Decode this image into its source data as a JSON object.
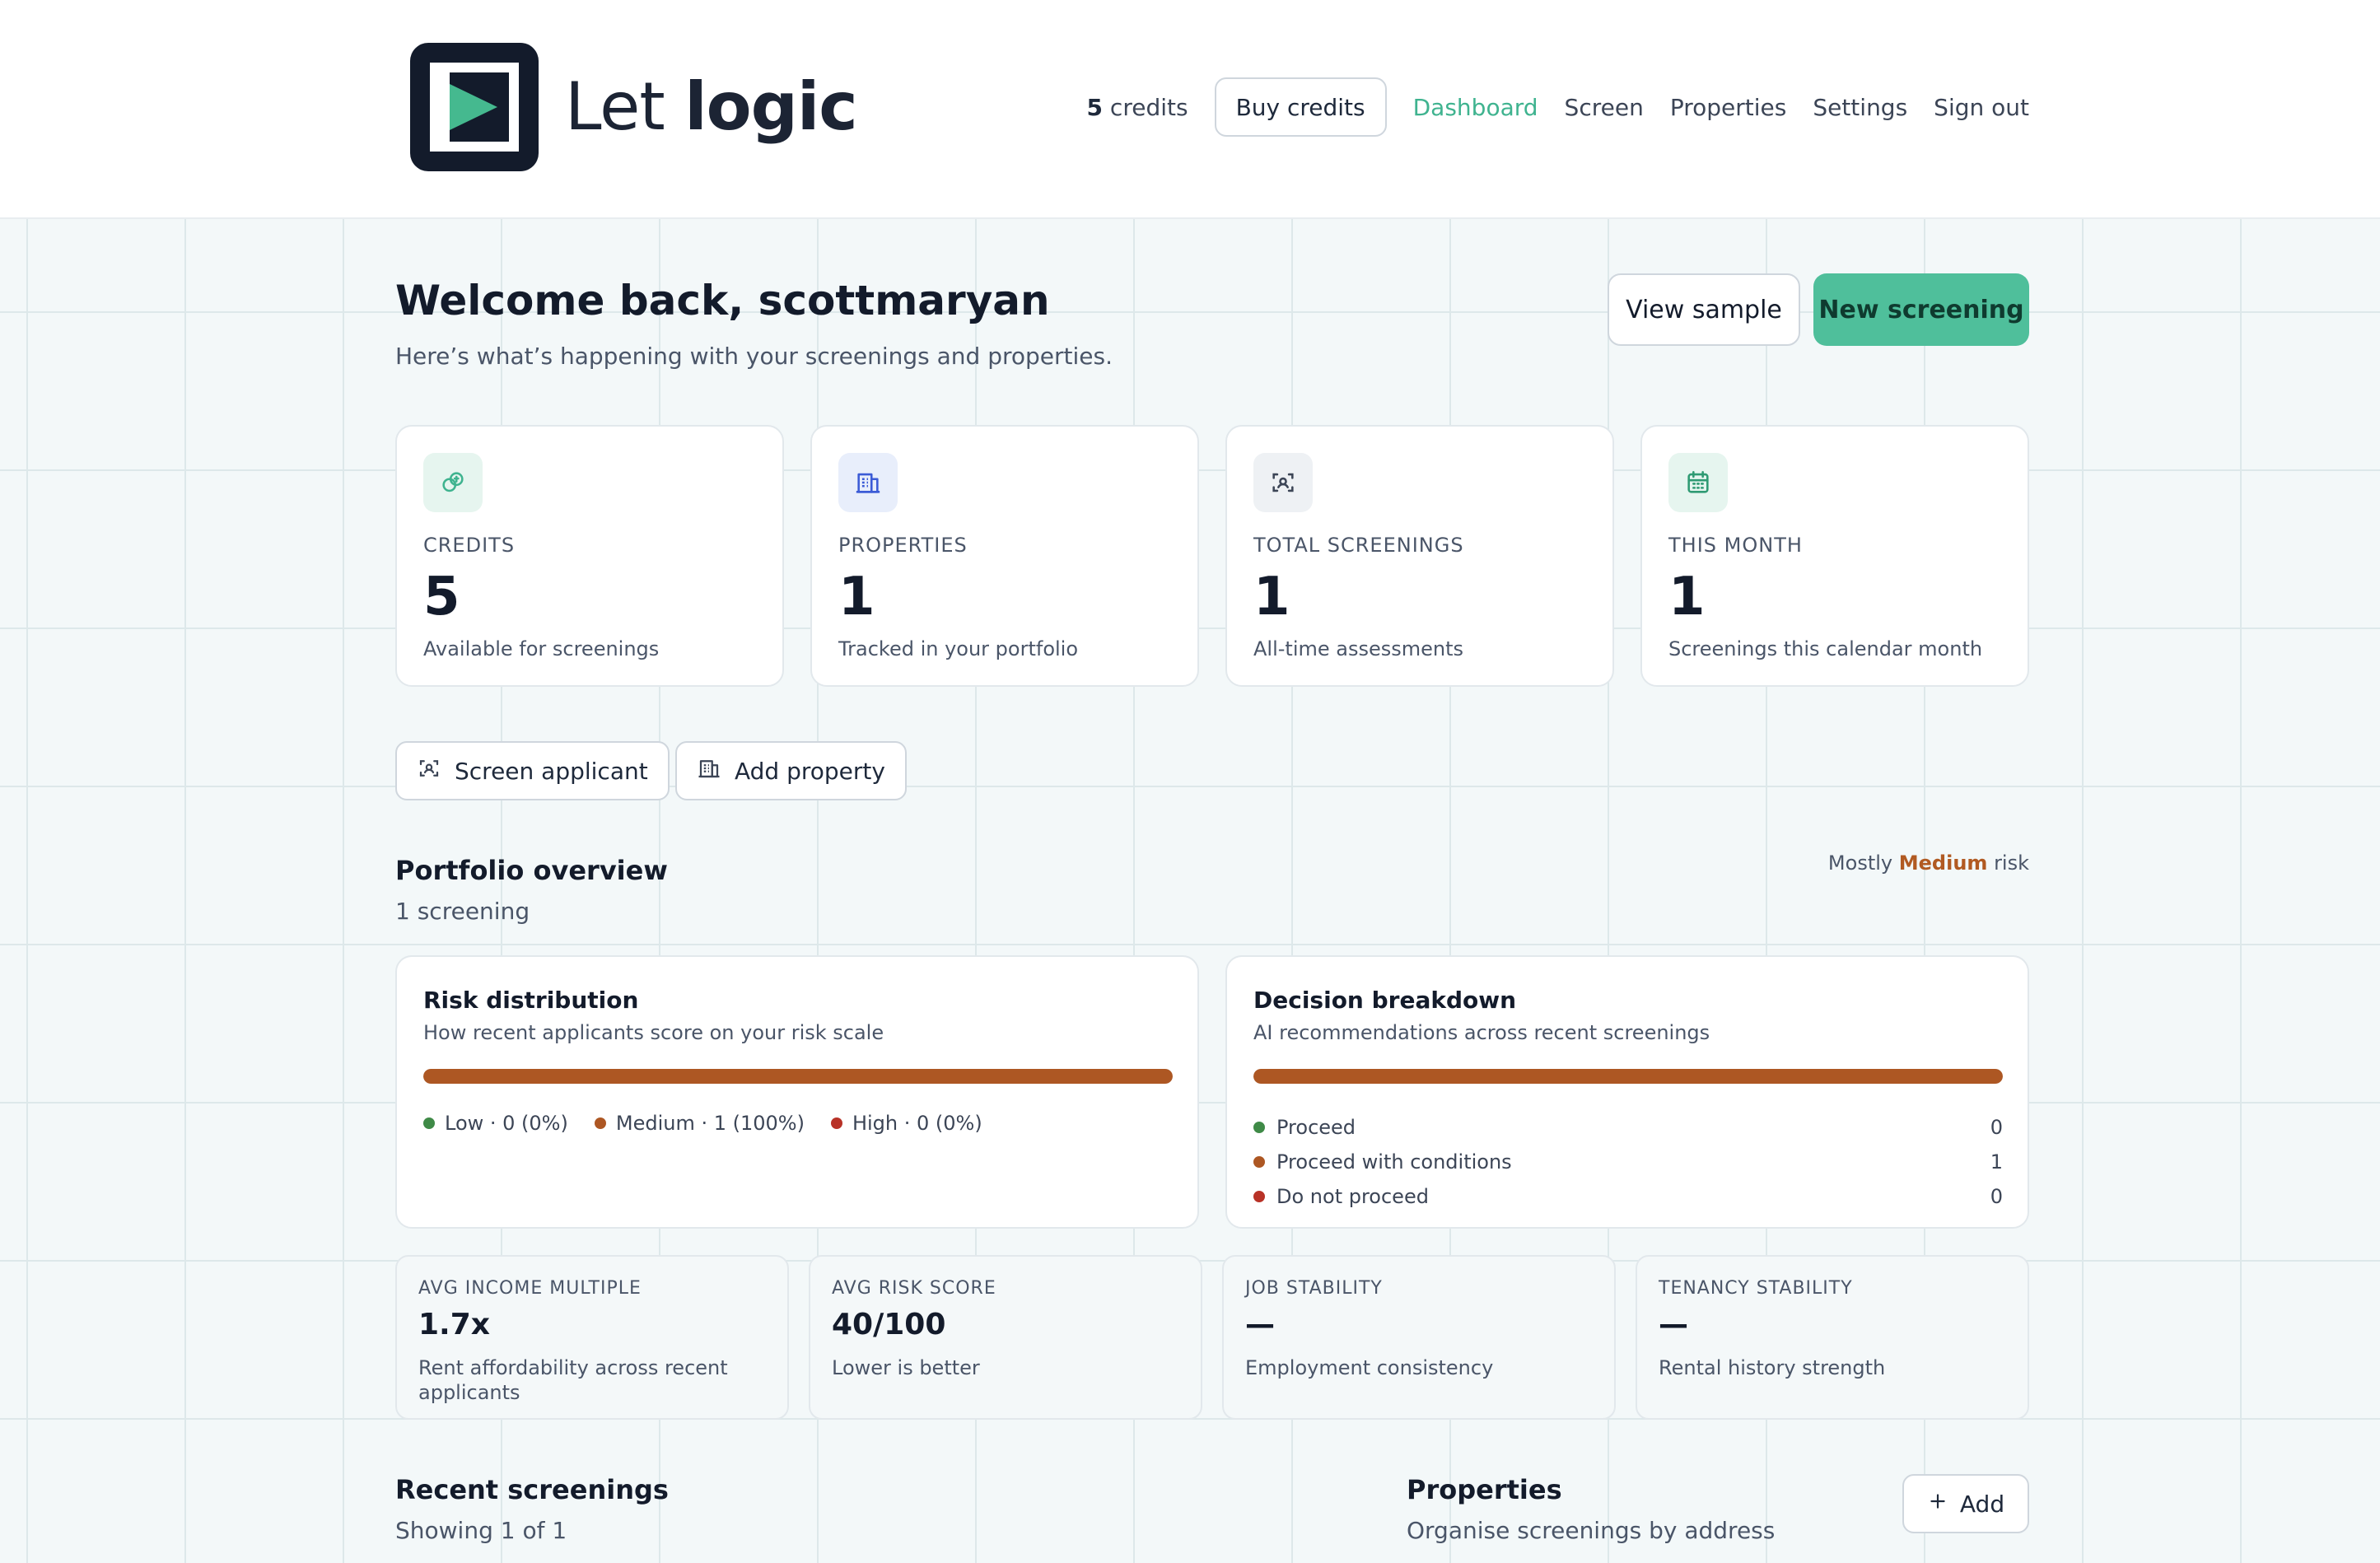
{
  "brand": {
    "name_light": "Let",
    "name_bold": "logic"
  },
  "nav": {
    "credits_count": "5",
    "credits_label": "credits",
    "buy_credits": "Buy credits",
    "links": [
      "Dashboard",
      "Screen",
      "Properties",
      "Settings",
      "Sign out"
    ],
    "active": "Dashboard"
  },
  "welcome": {
    "title": "Welcome back, scottmaryan",
    "subtitle": "Here’s what’s happening with your screenings and properties.",
    "view_sample": "View sample",
    "new_screening": "New screening"
  },
  "stats": [
    {
      "icon": "coins-icon",
      "label": "CREDITS",
      "value": "5",
      "desc": "Available for screenings",
      "icon_bg": "#e6f5ef",
      "icon_color": "#3fb38f"
    },
    {
      "icon": "building-icon",
      "label": "PROPERTIES",
      "value": "1",
      "desc": "Tracked in your portfolio",
      "icon_bg": "#e8eefb",
      "icon_color": "#3b5bd6"
    },
    {
      "icon": "scan-user-icon",
      "label": "TOTAL SCREENINGS",
      "value": "1",
      "desc": "All-time assessments",
      "icon_bg": "#eef1f4",
      "icon_color": "#3c4556"
    },
    {
      "icon": "calendar-icon",
      "label": "THIS MONTH",
      "value": "1",
      "desc": "Screenings this calendar month",
      "icon_bg": "#e6f5ef",
      "icon_color": "#2f9a73"
    }
  ],
  "quick_actions": {
    "screen_applicant": "Screen applicant",
    "add_property": "Add property"
  },
  "portfolio": {
    "title": "Portfolio overview",
    "subtitle": "1 screening",
    "risk_note_prefix": "Mostly",
    "risk_note_level": "Medium",
    "risk_note_suffix": "risk"
  },
  "risk_distribution": {
    "title": "Risk distribution",
    "subtitle": "How recent applicants score on your risk scale",
    "legend": [
      {
        "label": "Low · 0  (0%)",
        "color": "#3f8a47",
        "fraction": 0
      },
      {
        "label": "Medium · 1  (100%)",
        "color": "#ad5723",
        "fraction": 1
      },
      {
        "label": "High · 0  (0%)",
        "color": "#b83227",
        "fraction": 0
      }
    ]
  },
  "decision_breakdown": {
    "title": "Decision breakdown",
    "subtitle": "AI recommendations across recent screenings",
    "fill_fraction": 1,
    "rows": [
      {
        "label": "Proceed",
        "count": "0",
        "color": "#3f8a47"
      },
      {
        "label": "Proceed with conditions",
        "count": "1",
        "color": "#ad5723"
      },
      {
        "label": "Do not proceed",
        "count": "0",
        "color": "#b83227"
      }
    ]
  },
  "metrics": [
    {
      "label": "AVG INCOME MULTIPLE",
      "value": "1.7x",
      "desc": "Rent affordability across recent applicants"
    },
    {
      "label": "AVG RISK SCORE",
      "value": "40/100",
      "desc": "Lower is better"
    },
    {
      "label": "JOB STABILITY",
      "value": "—",
      "desc": "Employment consistency"
    },
    {
      "label": "TENANCY STABILITY",
      "value": "—",
      "desc": "Rental history strength"
    }
  ],
  "recent": {
    "title": "Recent screenings",
    "subtitle": "Showing 1 of 1"
  },
  "properties": {
    "title": "Properties",
    "subtitle": "Organise screenings by address",
    "add": "Add"
  },
  "colors": {
    "accent": "#4fbf9b",
    "medium": "#ad5723",
    "brand_dark": "#131b2b"
  }
}
